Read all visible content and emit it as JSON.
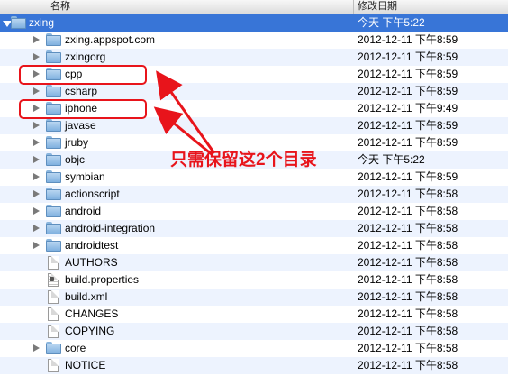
{
  "header": {
    "name_label": "名称",
    "date_label": "修改日期"
  },
  "rows": [
    {
      "name": "zxing",
      "date": "今天 下午5:22",
      "type": "folder",
      "level": 0,
      "expanded": true,
      "selected": true
    },
    {
      "name": "zxing.appspot.com",
      "date": "2012-12-11 下午8:59",
      "type": "folder",
      "level": 1
    },
    {
      "name": "zxingorg",
      "date": "2012-12-11 下午8:59",
      "type": "folder",
      "level": 1
    },
    {
      "name": "cpp",
      "date": "2012-12-11 下午8:59",
      "type": "folder",
      "level": 1
    },
    {
      "name": "csharp",
      "date": "2012-12-11 下午8:59",
      "type": "folder",
      "level": 1
    },
    {
      "name": "iphone",
      "date": "2012-12-11 下午9:49",
      "type": "folder",
      "level": 1
    },
    {
      "name": "javase",
      "date": "2012-12-11 下午8:59",
      "type": "folder",
      "level": 1
    },
    {
      "name": "jruby",
      "date": "2012-12-11 下午8:59",
      "type": "folder",
      "level": 1
    },
    {
      "name": "objc",
      "date": "今天 下午5:22",
      "type": "folder",
      "level": 1
    },
    {
      "name": "symbian",
      "date": "2012-12-11 下午8:59",
      "type": "folder",
      "level": 1
    },
    {
      "name": "actionscript",
      "date": "2012-12-11 下午8:58",
      "type": "folder",
      "level": 1
    },
    {
      "name": "android",
      "date": "2012-12-11 下午8:58",
      "type": "folder",
      "level": 1
    },
    {
      "name": "android-integration",
      "date": "2012-12-11 下午8:58",
      "type": "folder",
      "level": 1
    },
    {
      "name": "androidtest",
      "date": "2012-12-11 下午8:58",
      "type": "folder",
      "level": 1
    },
    {
      "name": "AUTHORS",
      "date": "2012-12-11 下午8:58",
      "type": "file",
      "level": 1
    },
    {
      "name": "build.properties",
      "date": "2012-12-11 下午8:58",
      "type": "props",
      "level": 1
    },
    {
      "name": "build.xml",
      "date": "2012-12-11 下午8:58",
      "type": "file",
      "level": 1
    },
    {
      "name": "CHANGES",
      "date": "2012-12-11 下午8:58",
      "type": "file",
      "level": 1
    },
    {
      "name": "COPYING",
      "date": "2012-12-11 下午8:58",
      "type": "file",
      "level": 1
    },
    {
      "name": "core",
      "date": "2012-12-11 下午8:58",
      "type": "folder",
      "level": 1
    },
    {
      "name": "NOTICE",
      "date": "2012-12-11 下午8:58",
      "type": "file",
      "level": 1
    }
  ],
  "annotation": {
    "text": "只需保留这2个目录",
    "color": "#e8141b"
  },
  "colors": {
    "selection": "#3875d7",
    "alt_row": "#edf3fe",
    "annotation": "#e8141b"
  },
  "icons": {
    "folder": "folder-icon",
    "file": "document-icon",
    "disclosure": "disclosure-triangle-icon"
  }
}
